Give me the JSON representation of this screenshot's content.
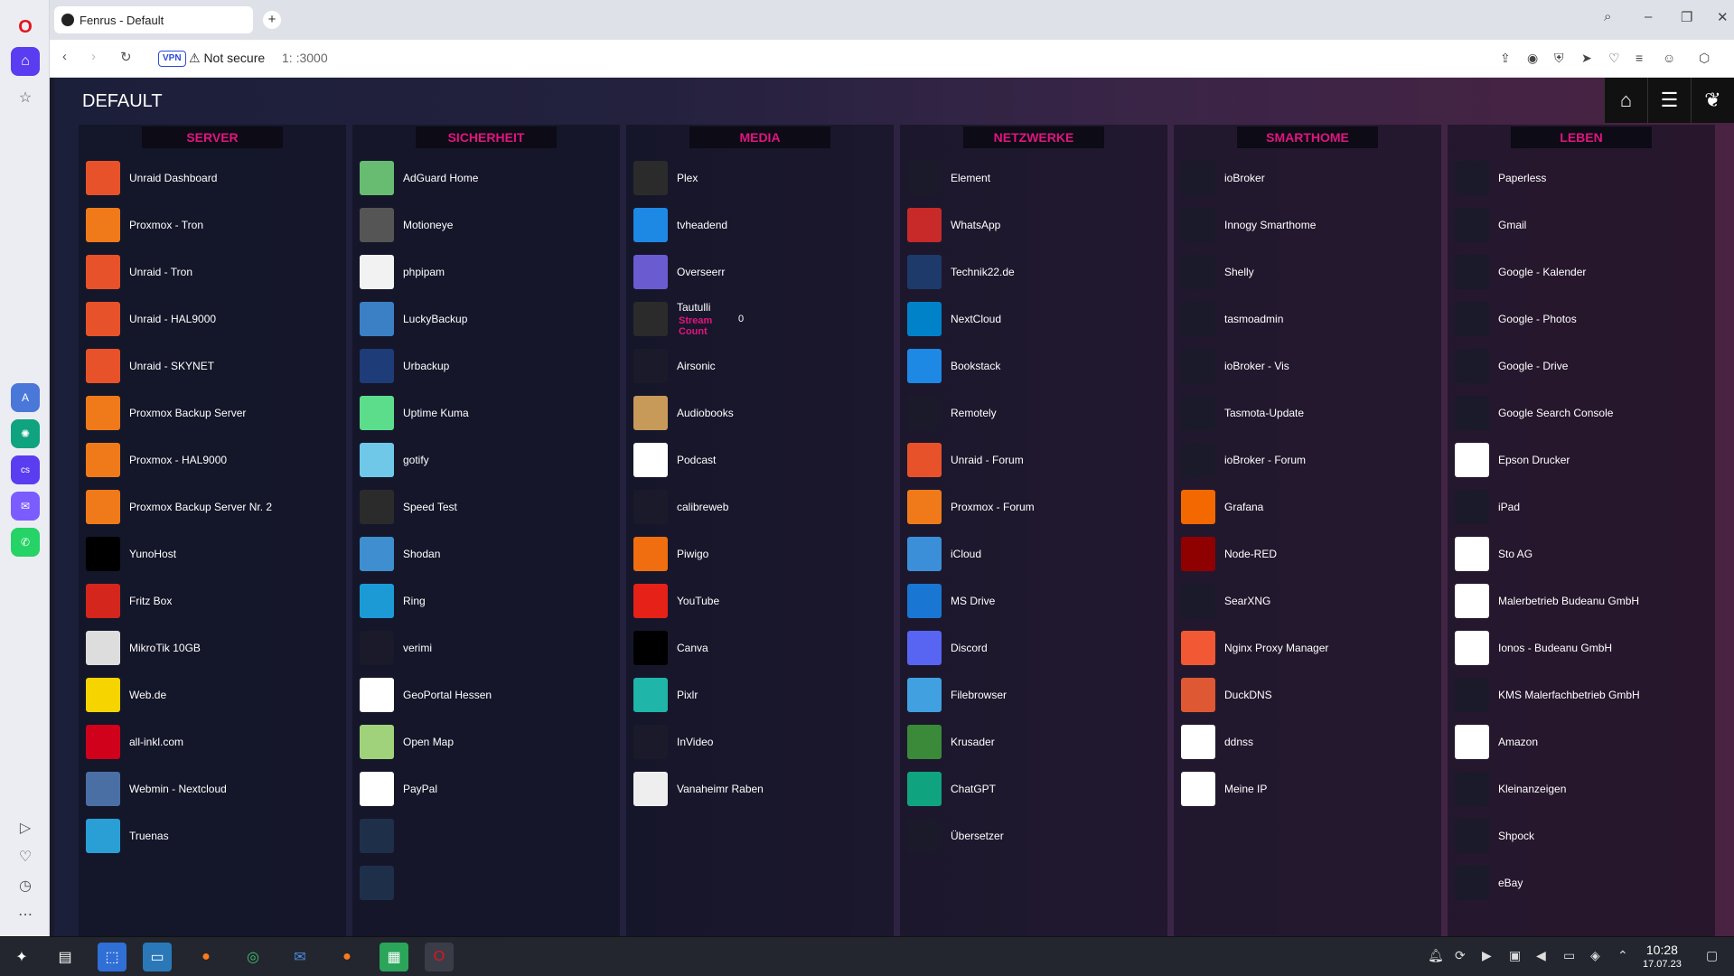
{
  "browser": {
    "tab_title": "Fenrus - Default",
    "new_tab": "+",
    "vpn": "VPN",
    "security": "⚠ Not secure",
    "url": "1:         :3000"
  },
  "dashboard": {
    "title": "DEFAULT",
    "groups": [
      {
        "title": "SERVER",
        "items": [
          {
            "label": "Unraid Dashboard",
            "color": "#e8522a",
            "icon": "unraid-icon"
          },
          {
            "label": "Proxmox - Tron",
            "color": "#f07a1a",
            "icon": "proxmox-icon"
          },
          {
            "label": "Unraid - Tron",
            "color": "#e8522a",
            "icon": "unraid-icon"
          },
          {
            "label": "Unraid - HAL9000",
            "color": "#e8522a",
            "icon": "unraid-icon"
          },
          {
            "label": "Unraid - SKYNET",
            "color": "#e8522a",
            "icon": "unraid-icon"
          },
          {
            "label": "Proxmox Backup Server",
            "color": "#f07a1a",
            "icon": "proxmox-icon"
          },
          {
            "label": "Proxmox - HAL9000",
            "color": "#f07a1a",
            "icon": "proxmox-icon"
          },
          {
            "label": "Proxmox Backup Server Nr. 2",
            "color": "#f07a1a",
            "icon": "proxmox-icon"
          },
          {
            "label": "YunoHost",
            "color": "#000000",
            "icon": "yunohost-icon"
          },
          {
            "label": "Fritz Box",
            "color": "#d4261c",
            "icon": "fritzbox-icon"
          },
          {
            "label": "MikroTik 10GB",
            "color": "#dddddd",
            "icon": "mikrotik-icon"
          },
          {
            "label": "Web.de",
            "color": "#f6d400",
            "icon": "webde-icon"
          },
          {
            "label": "all-inkl.com",
            "color": "#d0021b",
            "icon": "allinkl-icon"
          },
          {
            "label": "Webmin - Nextcloud",
            "color": "#4a6fa5",
            "icon": "webmin-icon"
          },
          {
            "label": "Truenas",
            "color": "#2a9fd6",
            "icon": "truenas-icon"
          }
        ]
      },
      {
        "title": "SICHERHEIT",
        "items": [
          {
            "label": "AdGuard Home",
            "color": "#68bc71",
            "icon": "adguard-icon"
          },
          {
            "label": "Motioneye",
            "color": "#555555",
            "icon": "motioneye-icon"
          },
          {
            "label": "phpipam",
            "color": "#f2f2f2",
            "icon": "phpipam-icon"
          },
          {
            "label": "LuckyBackup",
            "color": "#3b7fc4",
            "icon": "luckybackup-icon"
          },
          {
            "label": "Urbackup",
            "color": "#1d3c78",
            "icon": "urbackup-icon"
          },
          {
            "label": "Uptime Kuma",
            "color": "#5cdd8b",
            "icon": "uptime-kuma-icon"
          },
          {
            "label": "gotify",
            "color": "#6fc8e8",
            "icon": "gotify-icon"
          },
          {
            "label": "Speed Test",
            "color": "#2b2b2b",
            "icon": "speedtest-icon"
          },
          {
            "label": "Shodan",
            "color": "#3e8ed0",
            "icon": "shodan-icon"
          },
          {
            "label": "Ring",
            "color": "#1c9ad6",
            "icon": "ring-icon"
          },
          {
            "label": "verimi",
            "color": "#1a1a2a",
            "icon": "verimi-icon"
          },
          {
            "label": "GeoPortal Hessen",
            "color": "#ffffff",
            "icon": "geoportal-icon"
          },
          {
            "label": "Open Map",
            "color": "#9fd27a",
            "icon": "openmap-icon"
          },
          {
            "label": "PayPal",
            "color": "#ffffff",
            "icon": "paypal-icon"
          },
          {
            "label": "",
            "color": "#1e2f4a",
            "icon": "blank-icon"
          },
          {
            "label": "",
            "color": "#1e2f4a",
            "icon": "blank-icon"
          }
        ]
      },
      {
        "title": "MEDIA",
        "items": [
          {
            "label": "Plex",
            "color": "#2b2b2b",
            "icon": "plex-icon"
          },
          {
            "label": "tvheadend",
            "color": "#1e88e5",
            "icon": "tvheadend-icon"
          },
          {
            "label": "Overseerr",
            "color": "#6b5bd1",
            "icon": "overseerr-icon"
          },
          {
            "label": "Tautulli",
            "color": "#2b2b2b",
            "icon": "tautulli-icon",
            "stream_label": "Stream Count",
            "stream_value": "0"
          },
          {
            "label": "Airsonic",
            "color": "#1a1a2a",
            "icon": "airsonic-icon"
          },
          {
            "label": "Audiobooks",
            "color": "#c79a5a",
            "icon": "audiobooks-icon"
          },
          {
            "label": "Podcast",
            "color": "#ffffff",
            "icon": "podcast-icon"
          },
          {
            "label": "calibreweb",
            "color": "#1a1a2a",
            "icon": "calibre-icon"
          },
          {
            "label": "Piwigo",
            "color": "#f06e0f",
            "icon": "piwigo-icon"
          },
          {
            "label": "YouTube",
            "color": "#e62117",
            "icon": "youtube-icon"
          },
          {
            "label": "Canva",
            "color": "#000000",
            "icon": "canva-icon"
          },
          {
            "label": "Pixlr",
            "color": "#1fb5a8",
            "icon": "pixlr-icon"
          },
          {
            "label": "InVideo",
            "color": "#1a1a2a",
            "icon": "invideo-icon"
          },
          {
            "label": "Vanaheimr Raben",
            "color": "#eeeeee",
            "icon": "vanaheimr-icon"
          }
        ]
      },
      {
        "title": "NETZWERKE",
        "items": [
          {
            "label": "Element",
            "color": "#1a1a2a",
            "icon": "element-icon"
          },
          {
            "label": "WhatsApp",
            "color": "#c82a2a",
            "icon": "whatsapp-icon"
          },
          {
            "label": "Technik22.de",
            "color": "#1e3a6a",
            "icon": "technik22-icon"
          },
          {
            "label": "NextCloud",
            "color": "#0082c9",
            "icon": "nextcloud-icon"
          },
          {
            "label": "Bookstack",
            "color": "#1e88e5",
            "icon": "bookstack-icon"
          },
          {
            "label": "Remotely",
            "color": "#1a1a2a",
            "icon": "remotely-icon"
          },
          {
            "label": "Unraid - Forum",
            "color": "#e8522a",
            "icon": "unraid-icon"
          },
          {
            "label": "Proxmox - Forum",
            "color": "#f07a1a",
            "icon": "proxmox-icon"
          },
          {
            "label": "iCloud",
            "color": "#3b8fd9",
            "icon": "icloud-icon"
          },
          {
            "label": "MS Drive",
            "color": "#1976d2",
            "icon": "onedrive-icon"
          },
          {
            "label": "Discord",
            "color": "#5865f2",
            "icon": "discord-icon"
          },
          {
            "label": "Filebrowser",
            "color": "#40a0e0",
            "icon": "filebrowser-icon"
          },
          {
            "label": "Krusader",
            "color": "#3a8a3a",
            "icon": "krusader-icon"
          },
          {
            "label": "ChatGPT",
            "color": "#10a37f",
            "icon": "chatgpt-icon"
          },
          {
            "label": "Übersetzer",
            "color": "#1a1a2a",
            "icon": "translator-icon"
          }
        ]
      },
      {
        "title": "SMARTHOME",
        "items": [
          {
            "label": "ioBroker",
            "color": "#1a1a2a",
            "icon": "iobroker-icon"
          },
          {
            "label": "Innogy Smarthome",
            "color": "#1a1a2a",
            "icon": "innogy-icon"
          },
          {
            "label": "Shelly",
            "color": "#1a1a2a",
            "icon": "shelly-icon"
          },
          {
            "label": "tasmoadmin",
            "color": "#1a1a2a",
            "icon": "tasmota-icon"
          },
          {
            "label": "ioBroker - Vis",
            "color": "#1a1a2a",
            "icon": "iobroker-icon"
          },
          {
            "label": "Tasmota-Update",
            "color": "#1a1a2a",
            "icon": "tasmota-icon"
          },
          {
            "label": "ioBroker - Forum",
            "color": "#1a1a2a",
            "icon": "iobroker-icon"
          },
          {
            "label": "Grafana",
            "color": "#f46800",
            "icon": "grafana-icon"
          },
          {
            "label": "Node-RED",
            "color": "#8f0000",
            "icon": "nodered-icon"
          },
          {
            "label": "SearXNG",
            "color": "#1a1a2a",
            "icon": "searxng-icon"
          },
          {
            "label": "Nginx Proxy Manager",
            "color": "#f15833",
            "icon": "npm-icon"
          },
          {
            "label": "DuckDNS",
            "color": "#de5833",
            "icon": "duckdns-icon"
          },
          {
            "label": "ddnss",
            "color": "#ffffff",
            "icon": "ddnss-icon"
          },
          {
            "label": "Meine IP",
            "color": "#ffffff",
            "icon": "meineip-icon"
          }
        ]
      },
      {
        "title": "LEBEN",
        "items": [
          {
            "label": "Paperless",
            "color": "#1a1a2a",
            "icon": "paperless-icon"
          },
          {
            "label": "Gmail",
            "color": "#1a1a2a",
            "icon": "gmail-icon"
          },
          {
            "label": "Google - Kalender",
            "color": "#1a1a2a",
            "icon": "google-icon"
          },
          {
            "label": "Google - Photos",
            "color": "#1a1a2a",
            "icon": "google-icon"
          },
          {
            "label": "Google - Drive",
            "color": "#1a1a2a",
            "icon": "google-icon"
          },
          {
            "label": "Google Search Console",
            "color": "#1a1a2a",
            "icon": "google-icon"
          },
          {
            "label": "Epson Drucker",
            "color": "#ffffff",
            "icon": "epson-icon"
          },
          {
            "label": "iPad",
            "color": "#1a1a2a",
            "icon": "ipad-icon"
          },
          {
            "label": "Sto AG",
            "color": "#ffffff",
            "icon": "sto-icon"
          },
          {
            "label": "Malerbetrieb Budeanu GmbH",
            "color": "#ffffff",
            "icon": "malerbetrieb-icon"
          },
          {
            "label": "Ionos - Budeanu GmbH",
            "color": "#ffffff",
            "icon": "ionos-icon"
          },
          {
            "label": "KMS Malerfachbetrieb GmbH",
            "color": "#1a1a2a",
            "icon": "kms-icon"
          },
          {
            "label": "Amazon",
            "color": "#ffffff",
            "icon": "amazon-icon"
          },
          {
            "label": "Kleinanzeigen",
            "color": "#1a1a2a",
            "icon": "kleinanzeigen-icon"
          },
          {
            "label": "Shpock",
            "color": "#1a1a2a",
            "icon": "shpock-icon"
          },
          {
            "label": "eBay",
            "color": "#1a1a2a",
            "icon": "ebay-icon"
          }
        ]
      }
    ]
  },
  "taskbar": {
    "time": "10:28",
    "date": "17.07.23"
  }
}
